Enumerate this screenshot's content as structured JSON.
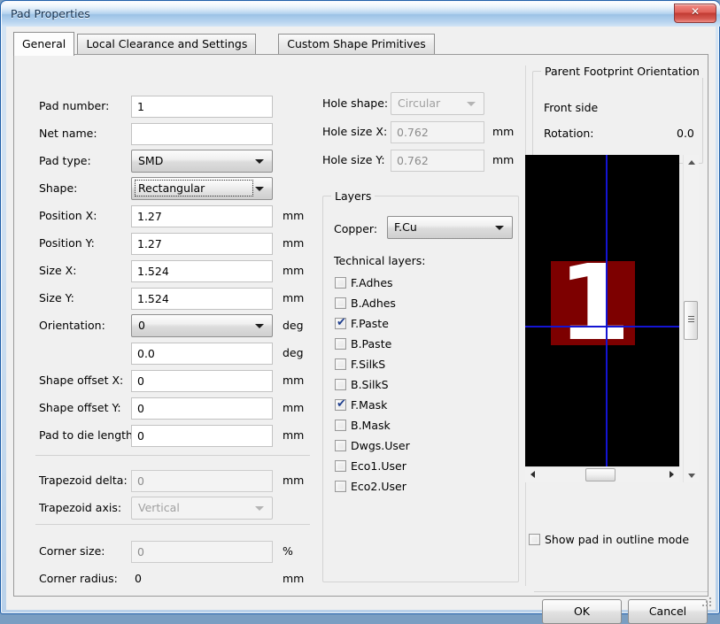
{
  "window": {
    "title": "Pad Properties",
    "close_label": "✕",
    "accent_titlebar": "#b5d3ef",
    "accent_border": "#1f5fa9"
  },
  "tabs": [
    {
      "label": "General",
      "active": true
    },
    {
      "label": "Local Clearance and Settings",
      "active": false
    },
    {
      "label": "Custom Shape Primitives",
      "active": false
    }
  ],
  "general": {
    "left_fields": [
      {
        "label": "Pad number:",
        "type": "text",
        "value": "1",
        "unit": "",
        "enabled": true,
        "focused": false
      },
      {
        "label": "Net name:",
        "type": "text",
        "value": "",
        "unit": "",
        "enabled": true,
        "focused": false
      },
      {
        "label": "Pad type:",
        "type": "combo",
        "value": "SMD",
        "unit": "",
        "enabled": true,
        "focused": false
      },
      {
        "label": "Shape:",
        "type": "combo",
        "value": "Rectangular",
        "unit": "",
        "enabled": true,
        "focused": true
      },
      {
        "label": "Position X:",
        "type": "text",
        "value": "1.27",
        "unit": "mm",
        "enabled": true,
        "focused": false
      },
      {
        "label": "Position Y:",
        "type": "text",
        "value": "1.27",
        "unit": "mm",
        "enabled": true,
        "focused": false
      },
      {
        "label": "Size X:",
        "type": "text",
        "value": "1.524",
        "unit": "mm",
        "enabled": true,
        "focused": false
      },
      {
        "label": "Size Y:",
        "type": "text",
        "value": "1.524",
        "unit": "mm",
        "enabled": true,
        "focused": false
      },
      {
        "label": "Orientation:",
        "type": "combo",
        "value": "0",
        "unit": "deg",
        "enabled": true,
        "focused": false
      },
      {
        "label": "",
        "type": "text",
        "value": "0.0",
        "unit": "deg",
        "enabled": true,
        "focused": false
      },
      {
        "label": "Shape offset X:",
        "type": "text",
        "value": "0",
        "unit": "mm",
        "enabled": true,
        "focused": false
      },
      {
        "label": "Shape offset Y:",
        "type": "text",
        "value": "0",
        "unit": "mm",
        "enabled": true,
        "focused": false
      },
      {
        "label": "Pad to die length:",
        "type": "text",
        "value": "0",
        "unit": "mm",
        "enabled": true,
        "focused": false
      },
      {
        "label": "Trapezoid delta:",
        "type": "text",
        "value": "0",
        "unit": "mm",
        "enabled": false,
        "focused": false
      },
      {
        "label": "Trapezoid axis:",
        "type": "combo",
        "value": "Vertical",
        "unit": "",
        "enabled": false,
        "focused": false
      },
      {
        "label": "Corner size:",
        "type": "text",
        "value": "0",
        "unit": "%",
        "enabled": false,
        "focused": false
      },
      {
        "label": "Corner radius:",
        "type": "static",
        "value": "0",
        "unit": "mm",
        "enabled": false,
        "focused": false
      }
    ],
    "hole_fields": [
      {
        "label": "Hole shape:",
        "type": "combo",
        "value": "Circular",
        "unit": "",
        "enabled": false
      },
      {
        "label": "Hole size X:",
        "type": "text",
        "value": "0.762",
        "unit": "mm",
        "enabled": false
      },
      {
        "label": "Hole size Y:",
        "type": "text",
        "value": "0.762",
        "unit": "mm",
        "enabled": false
      }
    ],
    "layers_group": {
      "title": "Layers",
      "copper_label": "Copper:",
      "copper_value": "F.Cu",
      "technical_label": "Technical layers:",
      "technical_layers": [
        {
          "label": "F.Adhes",
          "checked": false
        },
        {
          "label": "B.Adhes",
          "checked": false
        },
        {
          "label": "F.Paste",
          "checked": true
        },
        {
          "label": "B.Paste",
          "checked": false
        },
        {
          "label": "F.SilkS",
          "checked": false
        },
        {
          "label": "B.SilkS",
          "checked": false
        },
        {
          "label": "F.Mask",
          "checked": true
        },
        {
          "label": "B.Mask",
          "checked": false
        },
        {
          "label": "Dwgs.User",
          "checked": false
        },
        {
          "label": "Eco1.User",
          "checked": false
        },
        {
          "label": "Eco2.User",
          "checked": false
        }
      ]
    },
    "parent_orientation": {
      "title": "Parent Footprint Orientation",
      "side": "Front side",
      "rotation_label": "Rotation:",
      "rotation_value": "0.0"
    },
    "preview": {
      "pad_number": "1",
      "pad_color": "#7d0000",
      "crosshair_color": "#1414d2",
      "background_color": "#000000",
      "outline_mode_label": "Show pad in outline mode",
      "outline_mode_checked": false
    }
  },
  "footer": {
    "ok_label": "OK",
    "cancel_label": "Cancel"
  }
}
